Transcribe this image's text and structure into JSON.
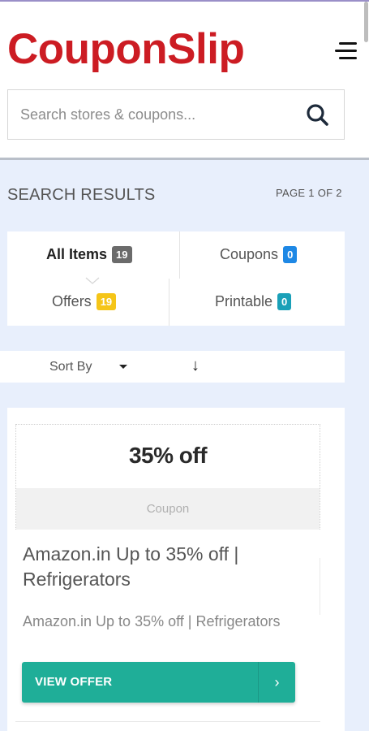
{
  "header": {
    "logo": "CouponSlip",
    "search": {
      "placeholder": "Search stores & coupons...",
      "value": ""
    }
  },
  "results": {
    "title": "SEARCH RESULTS",
    "page_info": "PAGE 1 OF 2"
  },
  "tabs": [
    {
      "label": "All Items",
      "count": "19",
      "active": true
    },
    {
      "label": "Coupons",
      "count": "0"
    },
    {
      "label": "Offers",
      "count": "19"
    },
    {
      "label": "Printable",
      "count": "0"
    }
  ],
  "sort": {
    "label": "Sort By",
    "direction_icon": "↓"
  },
  "card": {
    "value": "35% off",
    "type": "Coupon",
    "title": "Amazon.in Up to 35% off | Refrigerators",
    "description": "Amazon.in Up to 35% off | Refrigerators",
    "button_label": "VIEW OFFER",
    "button_arrow": "›"
  },
  "colors": {
    "brand": "#cc1c23",
    "accent": "#1fae98",
    "background": "#e8effc"
  }
}
